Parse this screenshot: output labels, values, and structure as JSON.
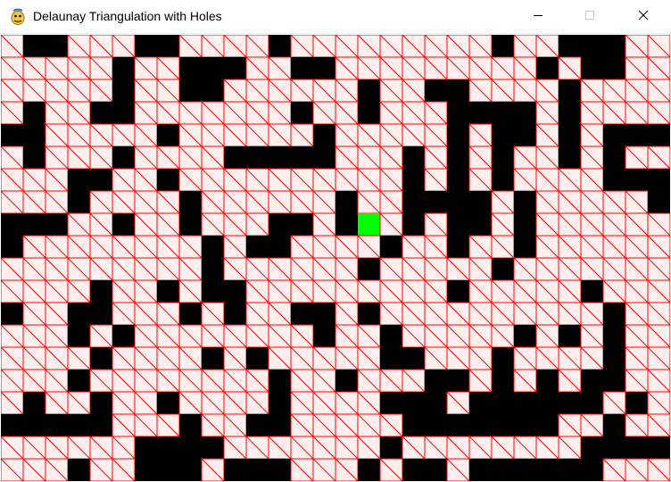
{
  "window": {
    "title": "Delaunay Triangulation with Holes"
  },
  "icons": {
    "app": "python-snake-icon",
    "minimize": "minimize-icon",
    "maximize": "maximize-icon",
    "close": "close-icon"
  },
  "grid": {
    "columns": 30,
    "rows": 20,
    "legend_cell_chars": "#=hole (black), .=triangulated cell, G=highlighted cell",
    "rows_map": [
      "#..#...##.....#.##.........####",
      "#######..#####.#######.##.####",
      "..............................",
      "..............................",
      "..............................",
      "..............................",
      "..............................",
      "..............................",
      "..............................",
      "..............................",
      "..............................",
      "..............................",
      "..............................",
      "..............................",
      "..............................",
      "..............................",
      "..............................",
      "..............................",
      "..............................",
      ".............................."
    ],
    "holes": [
      [
        0,
        1
      ],
      [
        0,
        2
      ],
      [
        0,
        6
      ],
      [
        0,
        7
      ],
      [
        0,
        12
      ],
      [
        0,
        22
      ],
      [
        0,
        25
      ],
      [
        0,
        26
      ],
      [
        0,
        27
      ],
      [
        1,
        5
      ],
      [
        1,
        8
      ],
      [
        1,
        9
      ],
      [
        1,
        10
      ],
      [
        1,
        13
      ],
      [
        1,
        14
      ],
      [
        1,
        24
      ],
      [
        1,
        26
      ],
      [
        1,
        27
      ],
      [
        2,
        5
      ],
      [
        2,
        8
      ],
      [
        2,
        9
      ],
      [
        2,
        16
      ],
      [
        2,
        19
      ],
      [
        2,
        20
      ],
      [
        2,
        25
      ],
      [
        3,
        1
      ],
      [
        3,
        4
      ],
      [
        3,
        5
      ],
      [
        3,
        13
      ],
      [
        3,
        16
      ],
      [
        3,
        20
      ],
      [
        3,
        21
      ],
      [
        3,
        22
      ],
      [
        3,
        23
      ],
      [
        3,
        25
      ],
      [
        4,
        0
      ],
      [
        4,
        1
      ],
      [
        4,
        7
      ],
      [
        4,
        14
      ],
      [
        4,
        20
      ],
      [
        4,
        22
      ],
      [
        4,
        23
      ],
      [
        4,
        25
      ],
      [
        4,
        27
      ],
      [
        4,
        28
      ],
      [
        4,
        29
      ],
      [
        5,
        1
      ],
      [
        5,
        5
      ],
      [
        5,
        10
      ],
      [
        5,
        11
      ],
      [
        5,
        12
      ],
      [
        5,
        13
      ],
      [
        5,
        14
      ],
      [
        5,
        18
      ],
      [
        5,
        20
      ],
      [
        5,
        22
      ],
      [
        5,
        25
      ],
      [
        5,
        27
      ],
      [
        6,
        3
      ],
      [
        6,
        4
      ],
      [
        6,
        7
      ],
      [
        6,
        18
      ],
      [
        6,
        20
      ],
      [
        6,
        22
      ],
      [
        6,
        27
      ],
      [
        6,
        28
      ],
      [
        6,
        29
      ],
      [
        7,
        3
      ],
      [
        7,
        8
      ],
      [
        7,
        15
      ],
      [
        7,
        18
      ],
      [
        7,
        19
      ],
      [
        7,
        20
      ],
      [
        7,
        21
      ],
      [
        7,
        23
      ],
      [
        7,
        29
      ],
      [
        8,
        0
      ],
      [
        8,
        1
      ],
      [
        8,
        2
      ],
      [
        8,
        5
      ],
      [
        8,
        8
      ],
      [
        8,
        12
      ],
      [
        8,
        13
      ],
      [
        8,
        15
      ],
      [
        8,
        18
      ],
      [
        8,
        20
      ],
      [
        8,
        21
      ],
      [
        8,
        23
      ],
      [
        9,
        0
      ],
      [
        9,
        9
      ],
      [
        9,
        11
      ],
      [
        9,
        12
      ],
      [
        9,
        17
      ],
      [
        9,
        20
      ],
      [
        9,
        23
      ],
      [
        10,
        9
      ],
      [
        10,
        16
      ],
      [
        10,
        22
      ],
      [
        11,
        4
      ],
      [
        11,
        7
      ],
      [
        11,
        9
      ],
      [
        11,
        10
      ],
      [
        11,
        20
      ],
      [
        11,
        26
      ],
      [
        12,
        0
      ],
      [
        12,
        3
      ],
      [
        12,
        4
      ],
      [
        12,
        8
      ],
      [
        12,
        10
      ],
      [
        12,
        13
      ],
      [
        12,
        14
      ],
      [
        12,
        16
      ],
      [
        12,
        27
      ],
      [
        13,
        3
      ],
      [
        13,
        5
      ],
      [
        13,
        14
      ],
      [
        13,
        17
      ],
      [
        13,
        23
      ],
      [
        13,
        25
      ],
      [
        13,
        27
      ],
      [
        14,
        4
      ],
      [
        14,
        9
      ],
      [
        14,
        11
      ],
      [
        14,
        17
      ],
      [
        14,
        18
      ],
      [
        14,
        22
      ],
      [
        14,
        27
      ],
      [
        15,
        3
      ],
      [
        15,
        12
      ],
      [
        15,
        15
      ],
      [
        15,
        19
      ],
      [
        15,
        20
      ],
      [
        15,
        22
      ],
      [
        15,
        24
      ],
      [
        15,
        26
      ],
      [
        15,
        27
      ],
      [
        16,
        1
      ],
      [
        16,
        4
      ],
      [
        16,
        7
      ],
      [
        16,
        12
      ],
      [
        16,
        17
      ],
      [
        16,
        18
      ],
      [
        16,
        19
      ],
      [
        16,
        21
      ],
      [
        16,
        22
      ],
      [
        16,
        23
      ],
      [
        16,
        24
      ],
      [
        16,
        25
      ],
      [
        16,
        26
      ],
      [
        16,
        28
      ],
      [
        17,
        0
      ],
      [
        17,
        1
      ],
      [
        17,
        2
      ],
      [
        17,
        3
      ],
      [
        17,
        4
      ],
      [
        17,
        8
      ],
      [
        17,
        11
      ],
      [
        17,
        12
      ],
      [
        17,
        18
      ],
      [
        17,
        19
      ],
      [
        17,
        20
      ],
      [
        17,
        21
      ],
      [
        17,
        22
      ],
      [
        17,
        23
      ],
      [
        17,
        24
      ],
      [
        17,
        27
      ],
      [
        18,
        6
      ],
      [
        18,
        7
      ],
      [
        18,
        8
      ],
      [
        18,
        9
      ],
      [
        18,
        17
      ],
      [
        18,
        26
      ],
      [
        18,
        27
      ],
      [
        18,
        28
      ],
      [
        18,
        29
      ],
      [
        19,
        3
      ],
      [
        19,
        6
      ],
      [
        19,
        7
      ],
      [
        19,
        8
      ],
      [
        19,
        10
      ],
      [
        19,
        11
      ],
      [
        19,
        12
      ],
      [
        19,
        16
      ],
      [
        19,
        18
      ],
      [
        19,
        19
      ],
      [
        19,
        21
      ],
      [
        19,
        22
      ],
      [
        19,
        23
      ],
      [
        19,
        24
      ],
      [
        19,
        25
      ],
      [
        19,
        26
      ]
    ],
    "highlight": [
      8,
      16
    ],
    "colors": {
      "hole": "#000000",
      "cell_fill": "#ffeeee",
      "line": "#ff0000",
      "highlight": "#00ff00"
    }
  }
}
